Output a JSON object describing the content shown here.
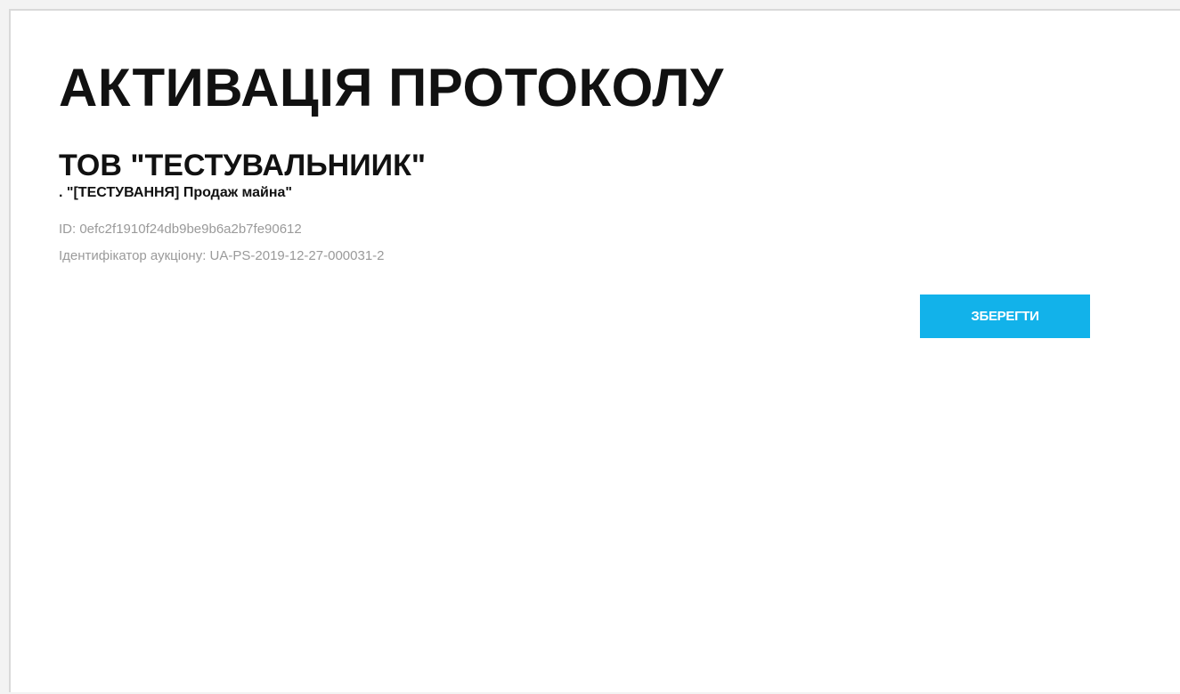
{
  "page": {
    "title": "АКТИВАЦІЯ ПРОТОКОЛУ",
    "organization": "ТОВ \"ТЕСТУВАЛЬНИИК\"",
    "lot_title": ". \"[ТЕСТУВАННЯ] Продаж майна\"",
    "id_line": "ID: 0efc2f1910f24db9be9b6a2b7fe90612",
    "auction_line": "Ідентифікатор аукціону: UA-PS-2019-12-27-000031-2"
  },
  "actions": {
    "save_label": "ЗБЕРЕГТИ"
  },
  "colors": {
    "accent": "#12b2ea",
    "text": "#111111",
    "muted": "#9a9a9a"
  }
}
